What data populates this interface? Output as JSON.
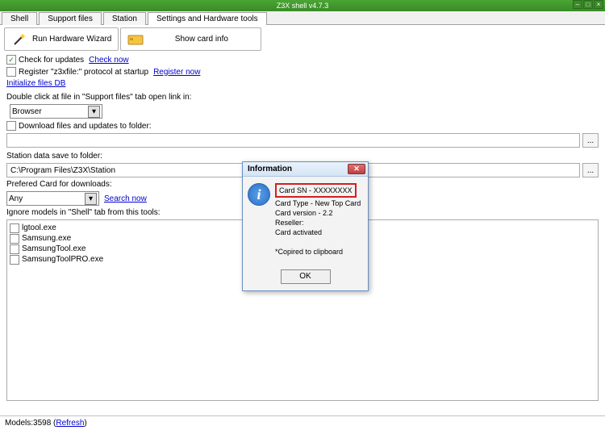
{
  "window": {
    "title": "Z3X shell v4.7.3"
  },
  "tabs": [
    "Shell",
    "Support files",
    "Station",
    "Settings and Hardware tools"
  ],
  "active_tab": 3,
  "toolbar": {
    "wizard_label": "Run Hardware Wizard",
    "cardinfo_label": "Show card info"
  },
  "checks": {
    "updates_label": "Check for updates",
    "updates_checked": true,
    "check_now": "Check now",
    "register_label": "Register \"z3xfile:\" protocol at startup",
    "register_checked": false,
    "register_now": "Register now",
    "init_db": "Initialize files DB"
  },
  "support_tab_label": "Double click at file in \"Support files\" tab open link in:",
  "open_link_in": "Browser",
  "download_folder_label": "Download files and updates to folder:",
  "download_folder_checked": false,
  "download_folder": "",
  "station_label": "Station data save to folder:",
  "station_path": "C:\\Program Files\\Z3X\\Station",
  "preferred_card_label": "Prefered Card for downloads:",
  "preferred_card": "Any",
  "search_now": "Search now",
  "ignore_label": "Ignore models in \"Shell\" tab from this tools:",
  "ignore_list": [
    "lgtool.exe",
    "Samsung.exe",
    "SamsungTool.exe",
    "SamsungToolPRO.exe"
  ],
  "status": {
    "models_label": "Models: ",
    "models_count": "3598",
    "refresh": "Refresh"
  },
  "dialog": {
    "title": "Information",
    "sn": "Card SN - XXXXXXXX",
    "type": "Card Type - New Top Card",
    "version": "Card version - 2.2",
    "reseller": "Reseller:",
    "activated": "Card activated",
    "copied": "*Copired to clipboard",
    "ok": "OK"
  }
}
